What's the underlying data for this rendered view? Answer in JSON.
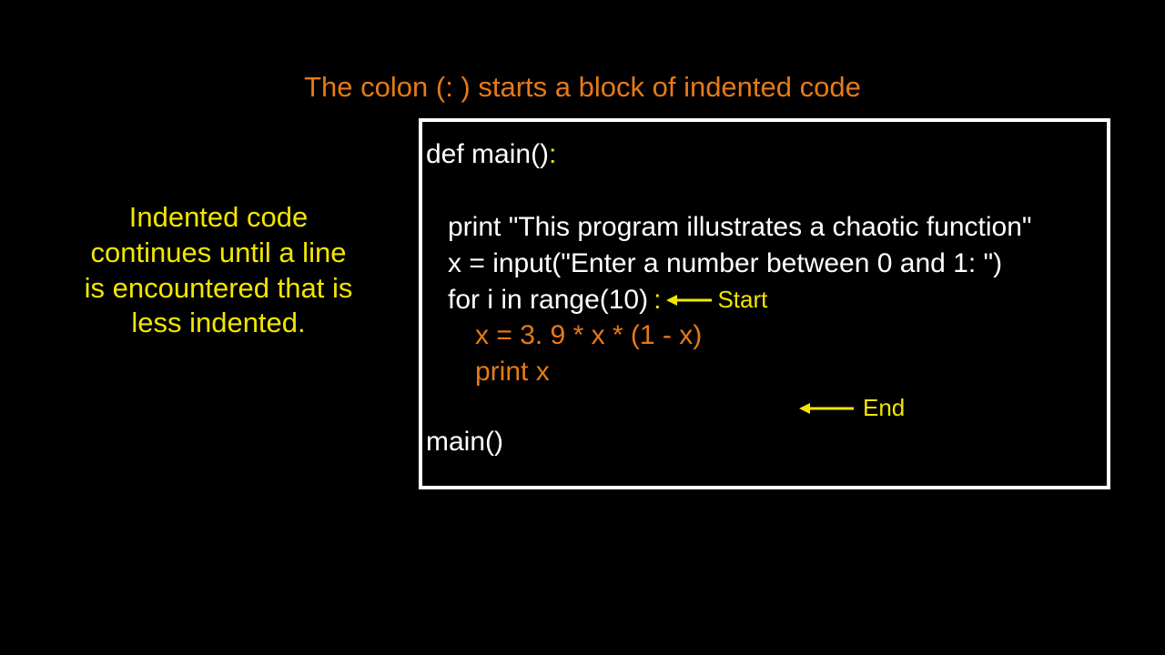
{
  "title": "The colon (: ) starts a block of indented code",
  "side_note": "Indented code continues until a line is encountered that is less indented.",
  "code": {
    "line1_a": "def main()",
    "line1_colon": ":",
    "blank": " ",
    "line2": "print \"This program illustrates a chaotic function\"",
    "line3": "x = input(\"Enter a number between 0 and 1: \")",
    "line4_a": "for i in range(10)",
    "line4_colon": ":",
    "line5": "x = 3. 9 * x * (1 - x)",
    "line6": "print x",
    "line7": "main()"
  },
  "annotations": {
    "start": "Start",
    "end": "End"
  }
}
